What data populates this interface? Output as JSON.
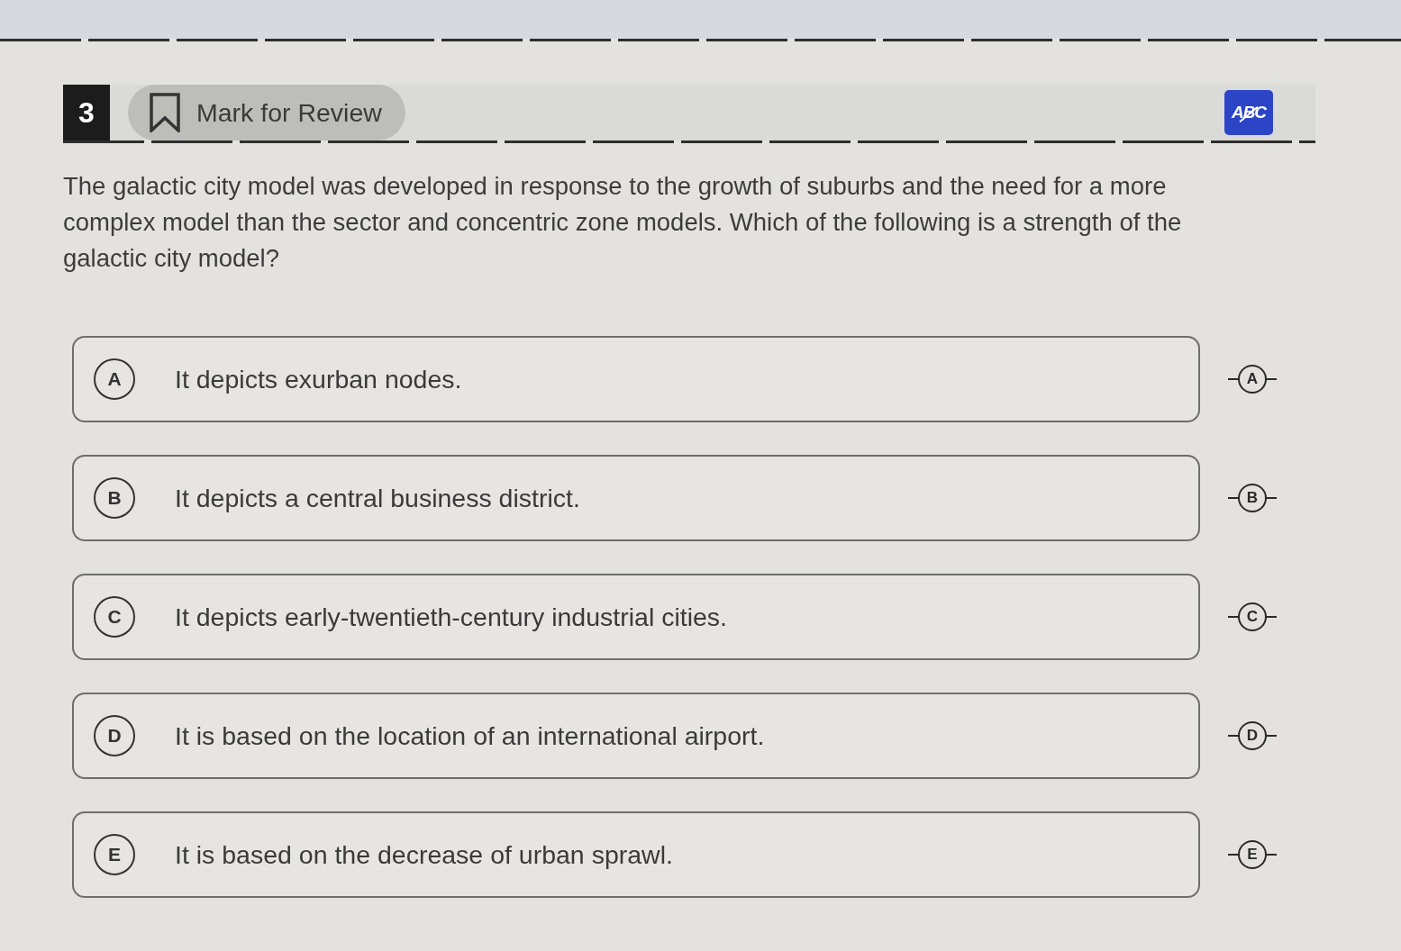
{
  "header": {
    "question_number": "3",
    "mark_for_review": {
      "label": "Mark for Review",
      "checked": false
    },
    "eliminator": {
      "label": "ABC",
      "selected": true
    }
  },
  "question": "The galactic city model was developed in response to the growth of suburbs and the need for a more complex model than the sector and concentric zone models. Which of the following is a strength of the galactic city model?",
  "options": [
    {
      "letter": "A",
      "text": "It depicts exurban nodes.",
      "selected": false,
      "strike_label": "A"
    },
    {
      "letter": "B",
      "text": "It depicts a central business district.",
      "selected": false,
      "strike_label": "B"
    },
    {
      "letter": "C",
      "text": "It depicts early-twentieth-century industrial cities.",
      "selected": false,
      "strike_label": "C"
    },
    {
      "letter": "D",
      "text": "It is based on the location of an international airport.",
      "selected": false,
      "strike_label": "D"
    },
    {
      "letter": "E",
      "text": "It is based on the decrease of urban sprawl.",
      "selected": false,
      "strike_label": "E"
    }
  ]
}
